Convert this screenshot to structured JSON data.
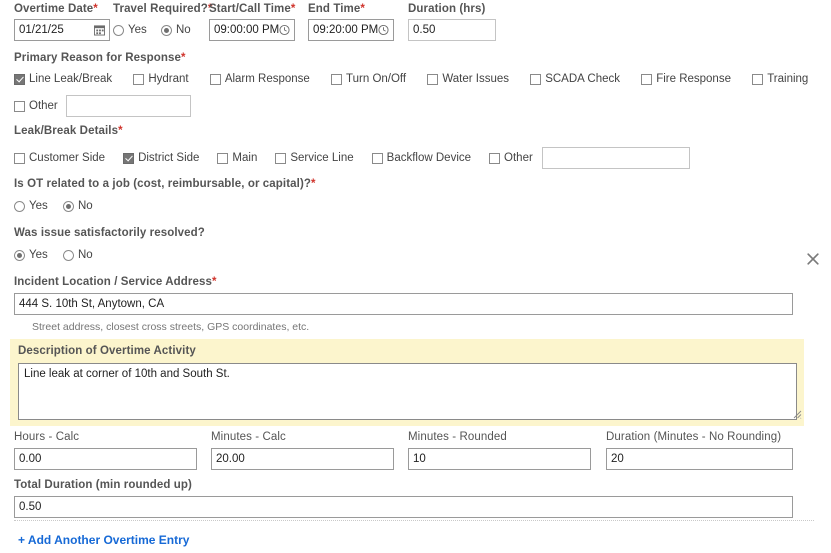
{
  "top_row": {
    "overtime_date": {
      "label": "Overtime Date",
      "required": "*",
      "value": "01/21/25",
      "icon": "calendar-icon"
    },
    "travel_required": {
      "label": "Travel Required?",
      "required": "*",
      "options": [
        {
          "label": "Yes",
          "selected": false
        },
        {
          "label": "No",
          "selected": true
        }
      ]
    },
    "start_call_time": {
      "label": "Start/Call Time",
      "required": "*",
      "value": "09:00:00 PM",
      "icon": "clock-icon"
    },
    "end_time": {
      "label": "End Time",
      "required": "*",
      "value": "09:20:00 PM",
      "icon": "clock-icon"
    },
    "duration_hrs": {
      "label": "Duration (hrs)",
      "required": "",
      "value": "0.50"
    }
  },
  "primary_reason": {
    "label": "Primary Reason for Response",
    "required": "*",
    "options": [
      {
        "label": "Line Leak/Break",
        "checked": true
      },
      {
        "label": "Hydrant",
        "checked": false
      },
      {
        "label": "Alarm Response",
        "checked": false
      },
      {
        "label": "Turn On/Off",
        "checked": false
      },
      {
        "label": "Water Issues",
        "checked": false
      },
      {
        "label": "SCADA Check",
        "checked": false
      },
      {
        "label": "Fire Response",
        "checked": false
      },
      {
        "label": "Training",
        "checked": false
      }
    ],
    "other": {
      "label": "Other",
      "checked": false,
      "value": ""
    }
  },
  "leak_break_details": {
    "label": "Leak/Break Details",
    "required": "*",
    "options": [
      {
        "label": "Customer Side",
        "checked": false
      },
      {
        "label": "District Side",
        "checked": true
      },
      {
        "label": "Main",
        "checked": false
      },
      {
        "label": "Service Line",
        "checked": false
      },
      {
        "label": "Backflow Device",
        "checked": false
      }
    ],
    "other": {
      "label": "Other",
      "checked": false,
      "value": ""
    }
  },
  "ot_related_to_job": {
    "label": "Is OT related to a job (cost, reimbursable, or capital)?",
    "required": "*",
    "options": [
      {
        "label": "Yes",
        "selected": false
      },
      {
        "label": "No",
        "selected": true
      }
    ]
  },
  "issue_resolved": {
    "label": "Was issue satisfactorily resolved?",
    "required": "",
    "options": [
      {
        "label": "Yes",
        "selected": true
      },
      {
        "label": "No",
        "selected": false
      }
    ]
  },
  "incident_location": {
    "label": "Incident Location / Service Address",
    "required": "*",
    "value": "444 S. 10th St, Anytown, CA",
    "hint": "Street address, closest cross streets, GPS coordinates, etc."
  },
  "description": {
    "label": "Description of Overtime Activity",
    "value": "Line leak at corner of 10th and South St.",
    "panel_color": "#fcf5cd"
  },
  "calc_row": {
    "hours_calc": {
      "label": "Hours - Calc",
      "value": "0.00"
    },
    "minutes_calc": {
      "label": "Minutes - Calc",
      "value": "20.00"
    },
    "minutes_rounded": {
      "label": "Minutes - Rounded",
      "value": "10"
    },
    "duration_minutes_no_rounding": {
      "label": "Duration (Minutes - No Rounding)",
      "value": "20"
    }
  },
  "total_duration": {
    "label": "Total Duration (min rounded up)",
    "value": "0.50"
  },
  "add_entry_link": {
    "label": "+ Add Another Overtime Entry",
    "color": "#1669d6"
  },
  "remove_entry": {
    "name": "close-icon",
    "color": "#7a7a7a"
  }
}
